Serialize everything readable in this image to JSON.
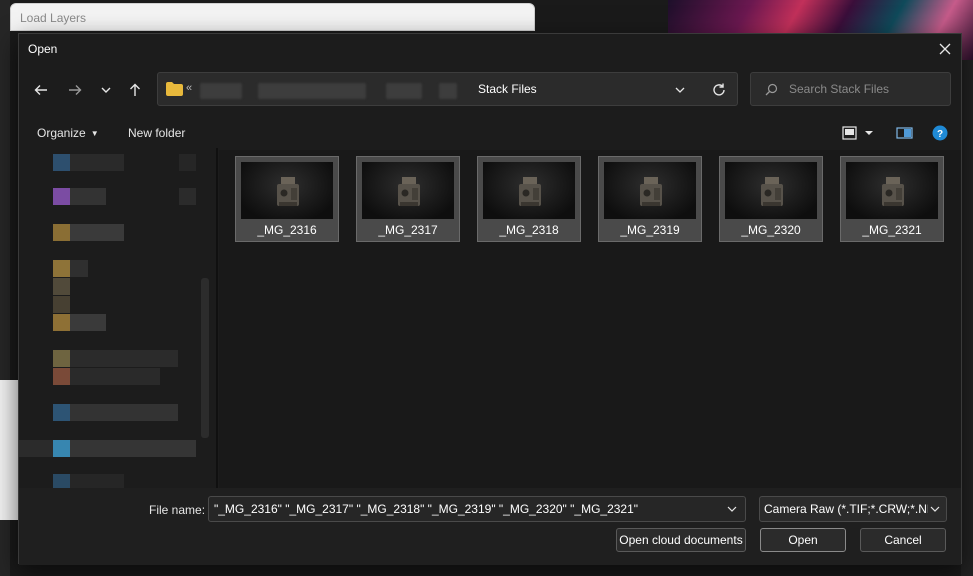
{
  "background": {
    "window_title": "Load Layers"
  },
  "dialog": {
    "title": "Open",
    "address": {
      "overflow_chevron": "«",
      "current_folder": "Stack Files"
    },
    "search": {
      "placeholder": "Search Stack Files"
    },
    "toolbar": {
      "organize_label": "Organize",
      "new_folder_label": "New folder"
    },
    "files": [
      {
        "name": "_MG_2316"
      },
      {
        "name": "_MG_2317"
      },
      {
        "name": "_MG_2318"
      },
      {
        "name": "_MG_2319"
      },
      {
        "name": "_MG_2320"
      },
      {
        "name": "_MG_2321"
      }
    ],
    "footer": {
      "file_name_label": "File name:",
      "file_name_value": "\"_MG_2316\" \"_MG_2317\" \"_MG_2318\" \"_MG_2319\" \"_MG_2320\" \"_MG_2321\"",
      "file_type_value": "Camera Raw (*.TIF;*.CRW;*.NEF",
      "open_cloud_label": "Open cloud documents",
      "open_label": "Open",
      "cancel_label": "Cancel"
    }
  },
  "colors": {
    "dialog_bg": "#1c1c1c",
    "accent_blue": "#1f8ad6"
  }
}
